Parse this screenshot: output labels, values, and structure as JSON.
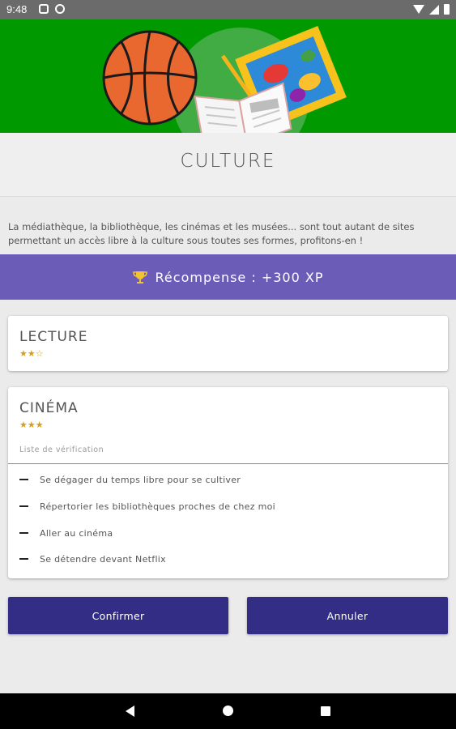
{
  "status_bar": {
    "time": "9:48"
  },
  "header": {
    "title": "CULTURE"
  },
  "description": "La médiathèque, la bibliothèque, les cinémas et les musées... sont tout autant de sites permettant un accès libre à la culture sous toutes ses formes, profitons-en !",
  "reward": {
    "label": "Récompense :  +300 XP",
    "icon": "trophy-icon"
  },
  "cards": [
    {
      "title": "LECTURE",
      "stars": "★★☆",
      "rating": 2,
      "max_rating": 3
    },
    {
      "title": "CINÉMA",
      "stars": "★★★",
      "rating": 3,
      "max_rating": 3,
      "checklist_label": "Liste de vérification",
      "checklist": [
        "Se dégager du temps libre pour se cultiver",
        "Répertorier les bibliothèques proches de chez moi",
        "Aller au cinéma",
        "Se détendre devant Netflix"
      ]
    }
  ],
  "buttons": {
    "confirm": "Confirmer",
    "cancel": "Annuler"
  },
  "colors": {
    "hero": "#009a00",
    "reward_banner": "#6a5cb7",
    "button": "#332d85",
    "stars": "#d4a017"
  }
}
